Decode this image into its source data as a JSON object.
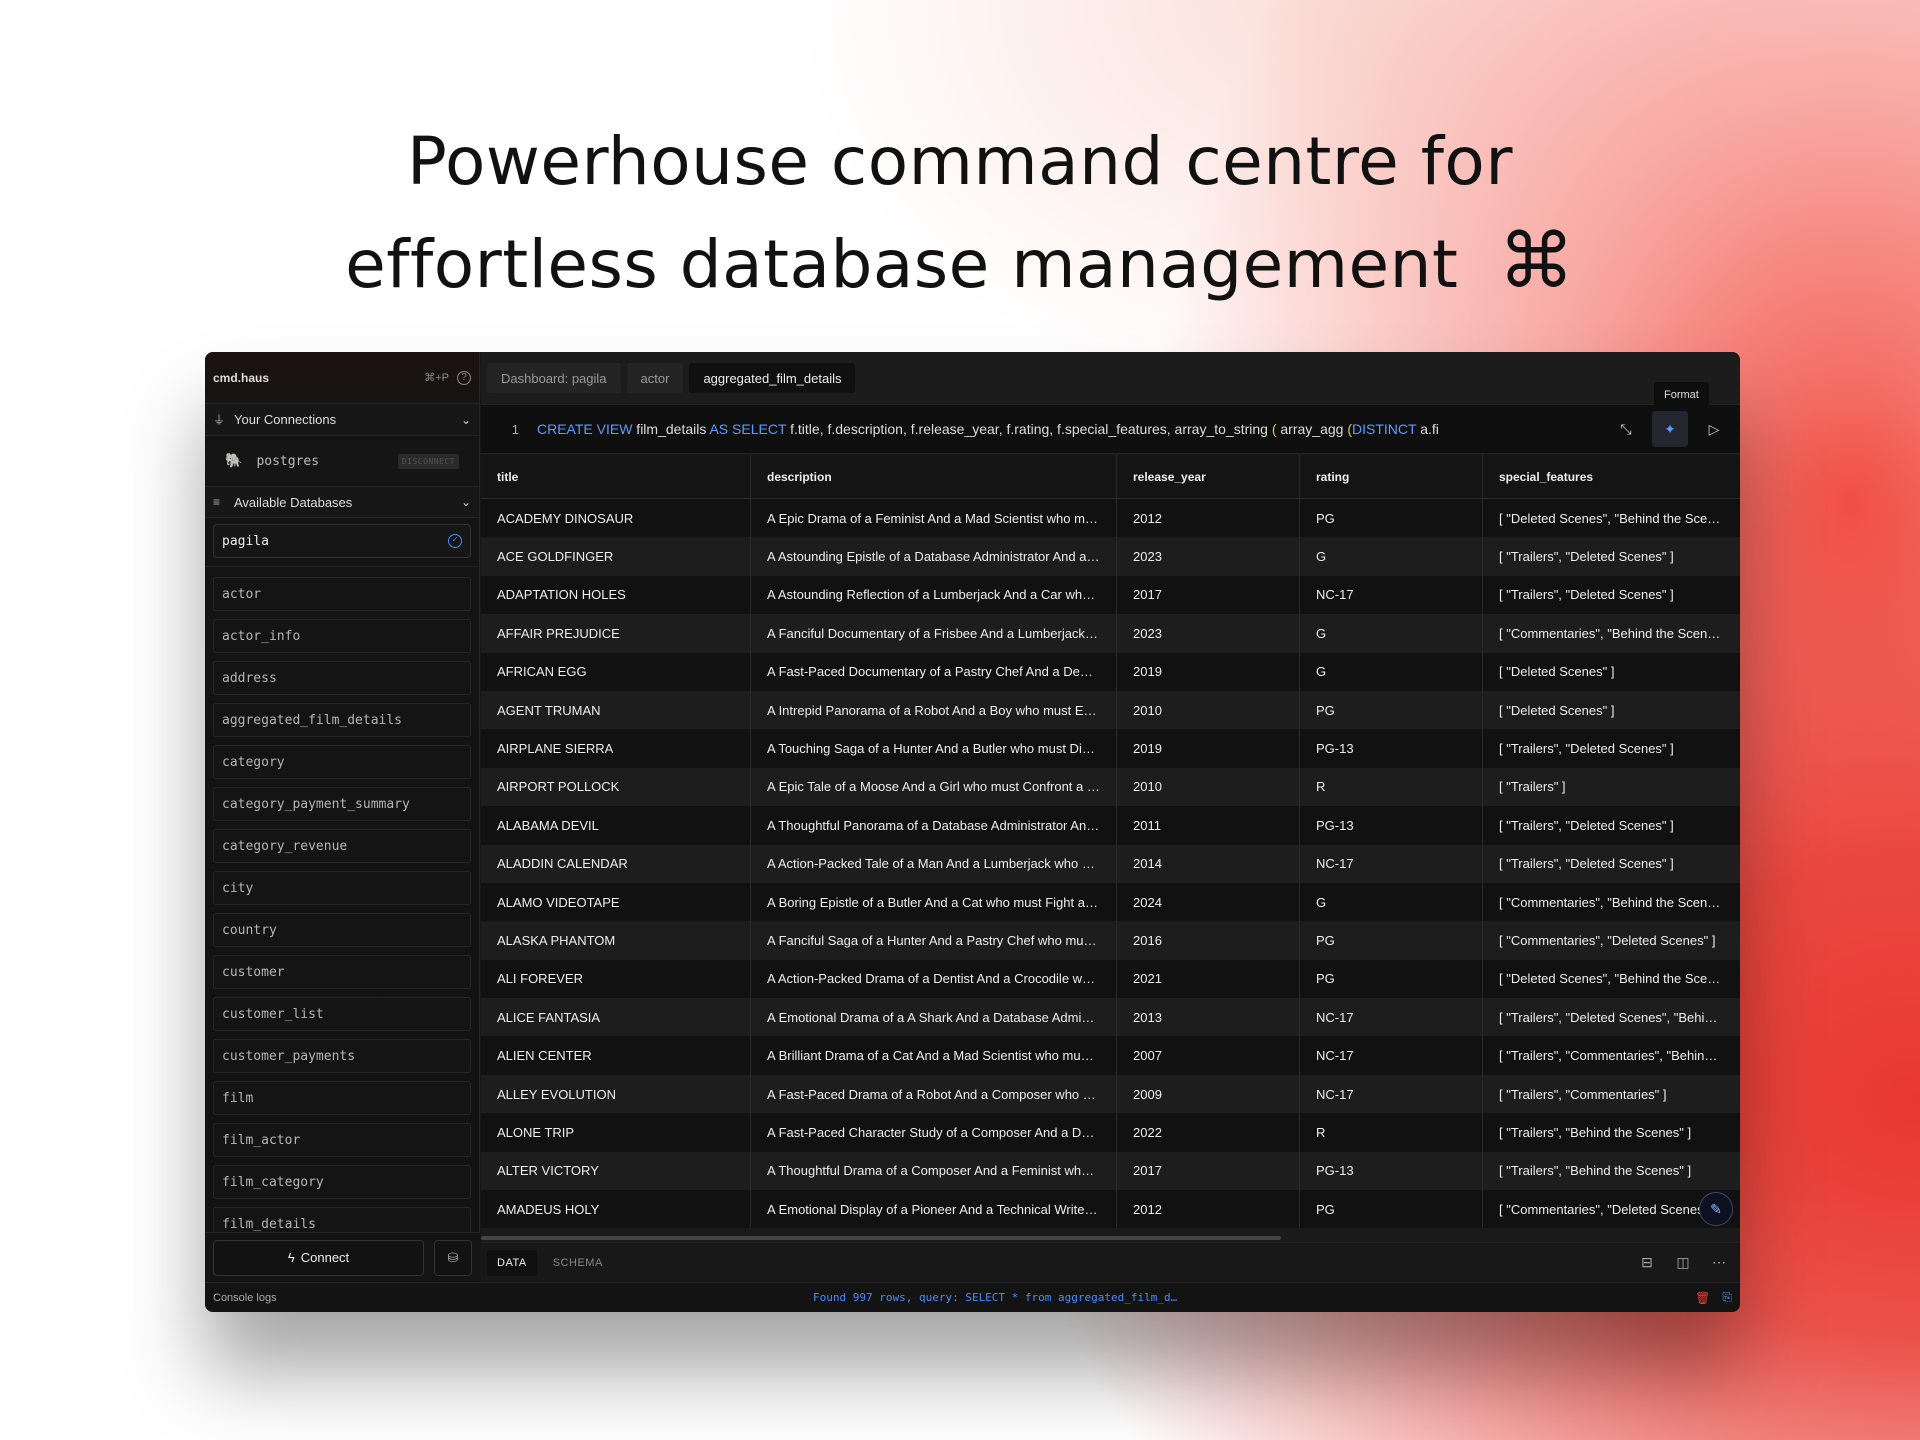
{
  "headline": {
    "line1": "Powerhouse command centre for",
    "line2": "effortless database management",
    "symbol": "⌘"
  },
  "sidebar": {
    "brand": "cmd.haus",
    "shortcut": "⌘+P",
    "connections_label": "Your Connections",
    "connection": {
      "name": "postgres",
      "action": "DISCONNECT"
    },
    "databases_label": "Available Databases",
    "selected_db": "pagila",
    "tables": [
      "actor",
      "actor_info",
      "address",
      "aggregated_film_details",
      "category",
      "category_payment_summary",
      "category_revenue",
      "city",
      "country",
      "customer",
      "customer_list",
      "customer_payments",
      "film",
      "film_actor",
      "film_category",
      "film_details"
    ],
    "connect_label": "Connect"
  },
  "tabs": [
    {
      "label": "Dashboard: pagila",
      "active": false
    },
    {
      "label": "actor",
      "active": false
    },
    {
      "label": "aggregated_film_details",
      "active": true
    }
  ],
  "tooltip": "Format",
  "editor": {
    "line_number": "1",
    "kw1": "CREATE VIEW",
    "t1": " film_details ",
    "kw2": "AS SELECT",
    "t2": " f.title, f.description, f.release_year, f.rating, f.special_features, array_to_string ",
    "p1": "(",
    "t3": " array_agg ",
    "p2": "(",
    "kw3": "DISTINCT",
    "t4": " a.fi"
  },
  "columns": [
    "title",
    "description",
    "release_year",
    "rating",
    "special_features"
  ],
  "rows": [
    [
      "ACADEMY DINOSAUR",
      "A Epic Drama of a Feminist And a Mad Scientist who must Battle a Teacher in The Canadian Rockies",
      "2012",
      "PG",
      "[ \"Deleted Scenes\", \"Behind the Scenes\" ]"
    ],
    [
      "ACE GOLDFINGER",
      "A Astounding Epistle of a Database Administrator And a Explorer who must Find a Car in Ancient China",
      "2023",
      "G",
      "[ \"Trailers\", \"Deleted Scenes\" ]"
    ],
    [
      "ADAPTATION HOLES",
      "A Astounding Reflection of a Lumberjack And a Car who must Sink a Lumberjack in A Baloon Factory",
      "2017",
      "NC-17",
      "[ \"Trailers\", \"Deleted Scenes\" ]"
    ],
    [
      "AFFAIR PREJUDICE",
      "A Fanciful Documentary of a Frisbee And a Lumberjack who must Chase a Monkey in A Shark Tank",
      "2023",
      "G",
      "[ \"Commentaries\", \"Behind the Scenes\" ]"
    ],
    [
      "AFRICAN EGG",
      "A Fast-Paced Documentary of a Pastry Chef And a Dentist who must Pursue a Forensic Psychologist",
      "2019",
      "G",
      "[ \"Deleted Scenes\" ]"
    ],
    [
      "AGENT TRUMAN",
      "A Intrepid Panorama of a Robot And a Boy who must Escape a Sumo Wrestler in Ancient China",
      "2010",
      "PG",
      "[ \"Deleted Scenes\" ]"
    ],
    [
      "AIRPLANE SIERRA",
      "A Touching Saga of a Hunter And a Butler who must Discover a Butler in A Jet Boat",
      "2019",
      "PG-13",
      "[ \"Trailers\", \"Deleted Scenes\" ]"
    ],
    [
      "AIRPORT POLLOCK",
      "A Epic Tale of a Moose And a Girl who must Confront a Monkey in Ancient India",
      "2010",
      "R",
      "[ \"Trailers\" ]"
    ],
    [
      "ALABAMA DEVIL",
      "A Thoughtful Panorama of a Database Administrator And a Mad Scientist who must Outgun a Mad Scientist",
      "2011",
      "PG-13",
      "[ \"Trailers\", \"Deleted Scenes\" ]"
    ],
    [
      "ALADDIN CALENDAR",
      "A Action-Packed Tale of a Man And a Lumberjack who must Reach a Feminist in Ancient China",
      "2014",
      "NC-17",
      "[ \"Trailers\", \"Deleted Scenes\" ]"
    ],
    [
      "ALAMO VIDEOTAPE",
      "A Boring Epistle of a Butler And a Cat who must Fight a Pastry Chef in A MySQL Convention",
      "2024",
      "G",
      "[ \"Commentaries\", \"Behind the Scenes\" ]"
    ],
    [
      "ALASKA PHANTOM",
      "A Fanciful Saga of a Hunter And a Pastry Chef who must Vanquish a Boy in Australia",
      "2016",
      "PG",
      "[ \"Commentaries\", \"Deleted Scenes\" ]"
    ],
    [
      "ALI FOREVER",
      "A Action-Packed Drama of a Dentist And a Crocodile who must Battle a Feminist in The Canadian Rockies",
      "2021",
      "PG",
      "[ \"Deleted Scenes\", \"Behind the Scenes\" ]"
    ],
    [
      "ALICE FANTASIA",
      "A Emotional Drama of a A Shark And a Database Administrator who must Vanquish a Pioneer in Soviet Georgia",
      "2013",
      "NC-17",
      "[ \"Trailers\", \"Deleted Scenes\", \"Behind the Scenes\" ]"
    ],
    [
      "ALIEN CENTER",
      "A Brilliant Drama of a Cat And a Mad Scientist who must Battle a Feminist in A MySQL Convention",
      "2007",
      "NC-17",
      "[ \"Trailers\", \"Commentaries\", \"Behind the Scenes\" ]"
    ],
    [
      "ALLEY EVOLUTION",
      "A Fast-Paced Drama of a Robot And a Composer who must Battle a Astronaut in New Orleans",
      "2009",
      "NC-17",
      "[ \"Trailers\", \"Commentaries\" ]"
    ],
    [
      "ALONE TRIP",
      "A Fast-Paced Character Study of a Composer And a Dog who must Outgun a Boat in An Abandoned Fun House",
      "2022",
      "R",
      "[ \"Trailers\", \"Behind the Scenes\" ]"
    ],
    [
      "ALTER VICTORY",
      "A Thoughtful Drama of a Composer And a Feminist who must Meet a Secret Agent in The Canadian Rockies",
      "2017",
      "PG-13",
      "[ \"Trailers\", \"Behind the Scenes\" ]"
    ],
    [
      "AMADEUS HOLY",
      "A Emotional Display of a Pioneer And a Technical Writer who must Battle a Man in A Baloon",
      "2012",
      "PG",
      "[ \"Commentaries\", \"Deleted Scenes\", \"Behind the Scenes\" ]"
    ]
  ],
  "bottom_tabs": [
    {
      "label": "DATA",
      "active": true
    },
    {
      "label": "SCHEMA",
      "active": false
    }
  ],
  "console": {
    "label": "Console logs",
    "message": "Found 997 rows, query: SELECT * from aggregated_film_d…"
  }
}
